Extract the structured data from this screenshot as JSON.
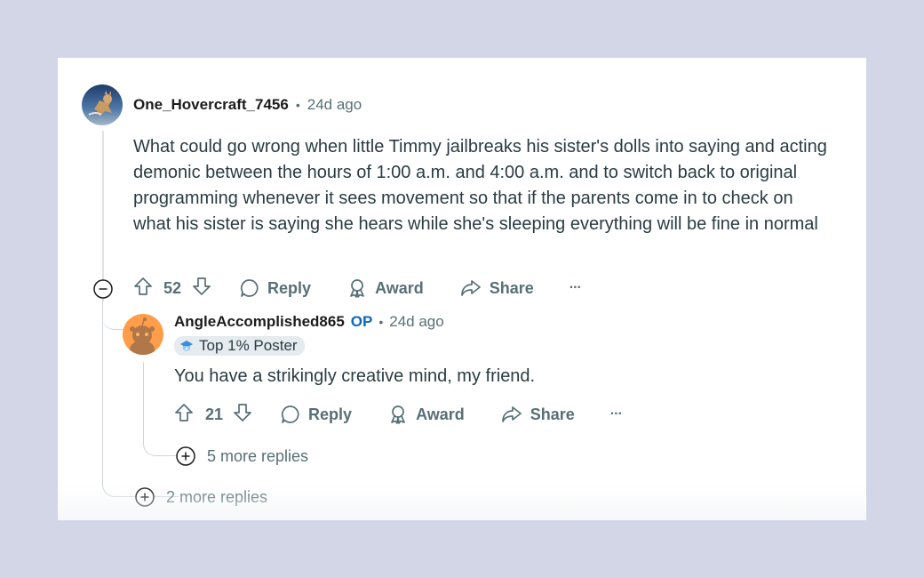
{
  "comment": {
    "avatar_icon": "cat-avatar",
    "username": "One_Hovercraft_7456",
    "separator": "•",
    "time": "24d ago",
    "body": "What could go wrong when little Timmy jailbreaks his sister's dolls into saying and acting demonic between the hours of 1:00 a.m. and 4:00 a.m. and to switch back to original programming whenever it sees movement so that if the parents come in to check on what his sister is saying she hears while she's sleeping everything will be fine in normal",
    "collapse_icon": "minus-circle-icon",
    "vote_count": "52",
    "reply_label": "Reply",
    "award_label": "Award",
    "share_label": "Share",
    "more_label": "···",
    "more_replies": "2 more replies"
  },
  "reply": {
    "avatar_icon": "snoo-avatar",
    "username": "AngleAccomplished865",
    "op_badge": "OP",
    "separator": "•",
    "time": "24d ago",
    "flair": "Top 1% Poster",
    "body": "You have a strikingly creative mind, my friend.",
    "vote_count": "21",
    "reply_label": "Reply",
    "award_label": "Award",
    "share_label": "Share",
    "more_label": "···",
    "more_replies": "5 more replies"
  },
  "colors": {
    "background": "#d3d6e6",
    "card": "#ffffff",
    "op": "#0a66c2",
    "meta": "#576f76",
    "avatar_orange": "#ff9e4a"
  }
}
